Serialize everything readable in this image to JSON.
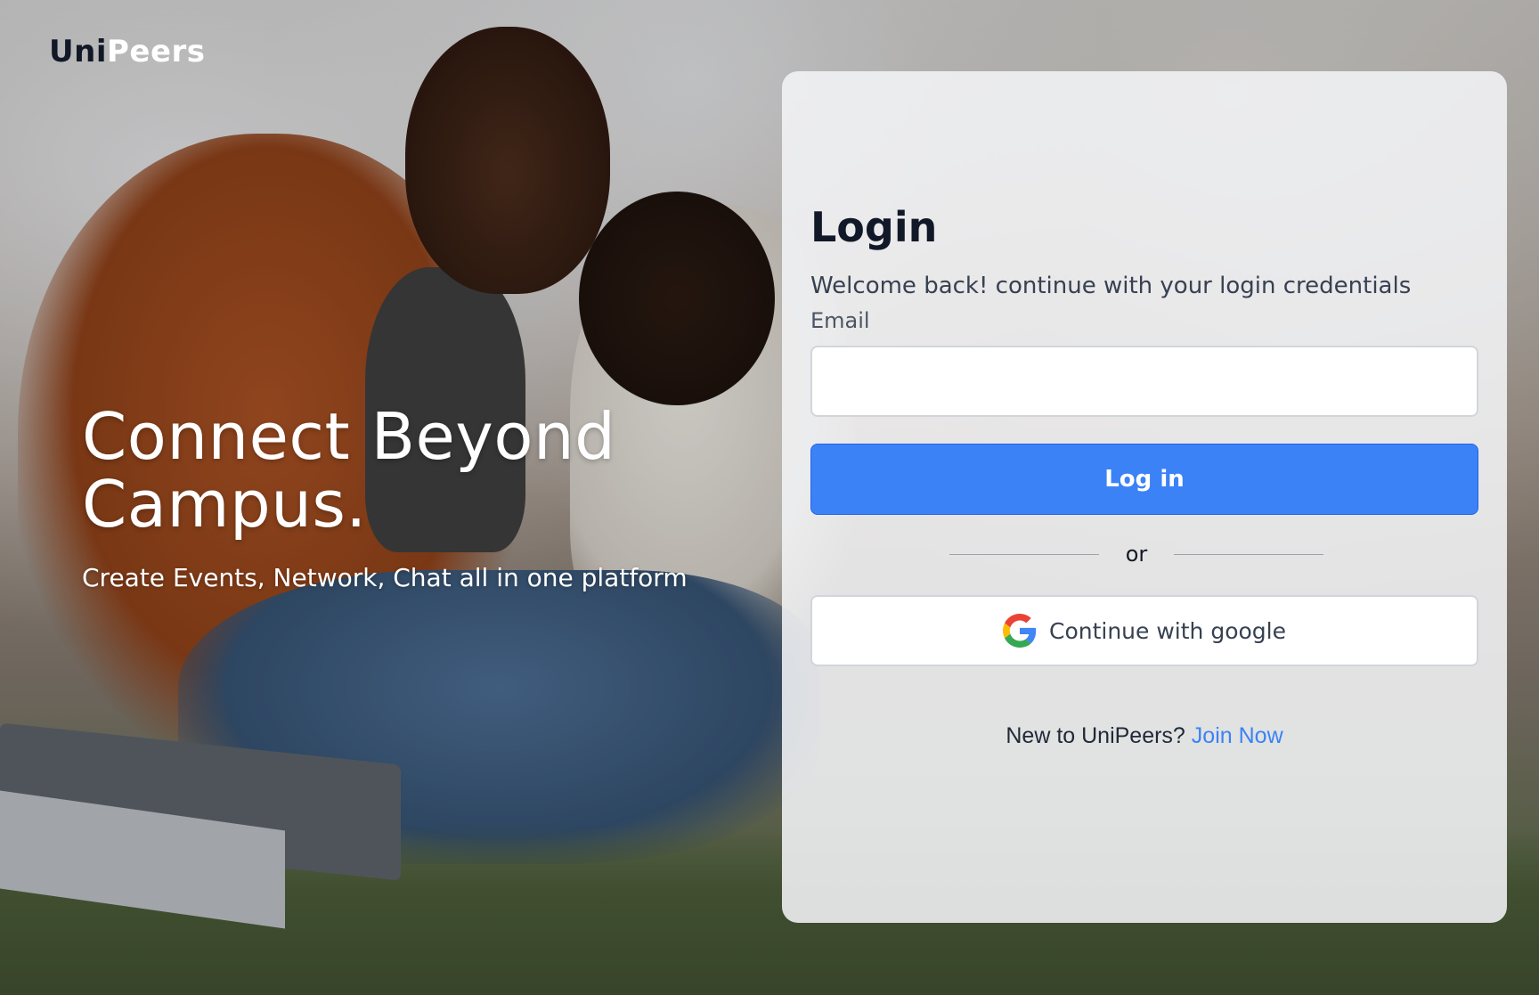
{
  "brand": {
    "part1": "Uni",
    "part2": "Peers"
  },
  "hero": {
    "title_line1": "Connect Beyond",
    "title_line2": "Campus.",
    "subtitle": "Create Events, Network, Chat all in one platform"
  },
  "login": {
    "title": "Login",
    "subtitle": "Welcome back! continue with your login credentials",
    "email_label": "Email",
    "email_value": "",
    "login_button": "Log in",
    "divider_text": "or",
    "google_button": "Continue with google",
    "google_icon": "google-icon",
    "signup_prompt": "New to UniPeers?",
    "signup_link": "Join Now"
  },
  "colors": {
    "primary": "#3b82f6",
    "link": "#3b82f6",
    "heading": "#111827",
    "card_background": "#f3f4f6"
  }
}
